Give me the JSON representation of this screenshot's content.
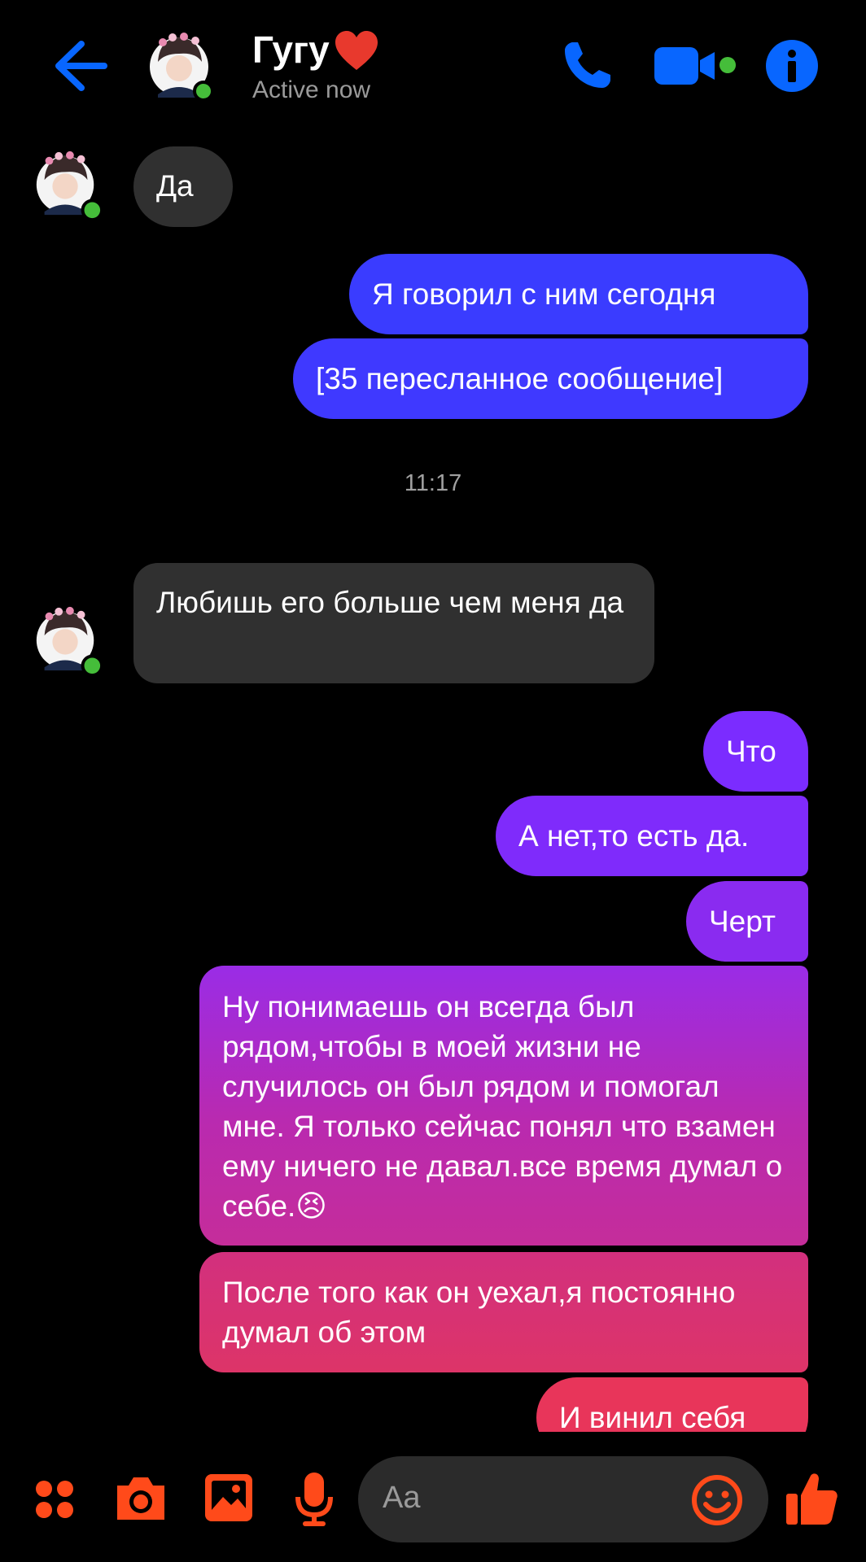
{
  "header": {
    "contact_name": "Гугу",
    "status": "Active now",
    "icons": [
      "back-arrow-icon",
      "avatar",
      "heart-icon",
      "phone-icon",
      "video-call-icon",
      "info-icon"
    ]
  },
  "messages": [
    {
      "direction": "incoming",
      "text": "Да"
    },
    {
      "direction": "outgoing",
      "text": "Я говорил с ним сегодня"
    },
    {
      "direction": "outgoing",
      "text": "[35 пересланное сообщение]"
    },
    {
      "type": "timestamp",
      "text": "11:17"
    },
    {
      "direction": "incoming",
      "text": "Любишь его больше чем меня да"
    },
    {
      "direction": "outgoing",
      "text": "Что"
    },
    {
      "direction": "outgoing",
      "text": "А нет,то есть да."
    },
    {
      "direction": "outgoing",
      "text": "Черт"
    },
    {
      "direction": "outgoing",
      "text": "Ну понимаешь он всегда был рядом,чтобы в моей жизни не случилось он был рядом и помогал мне. Я только сейчас понял что взамен ему ничего не давал.все время думал о себе.😣"
    },
    {
      "direction": "outgoing",
      "text": "После того как он уехал,я постоянно думал об этом"
    },
    {
      "direction": "outgoing",
      "text": "И винил себя"
    }
  ],
  "composer": {
    "placeholder": "Aa",
    "icons": [
      "apps-icon",
      "camera-icon",
      "gallery-icon",
      "mic-icon",
      "emoji-icon",
      "thumbs-up-icon"
    ]
  },
  "colors": {
    "accent_header": "#0866ff",
    "online": "#45bd3a",
    "incoming_bubble": "#303030",
    "outgoing_gradient": [
      "#3a3cff",
      "#7b2cff",
      "#a02cd8",
      "#d4307a",
      "#e8355a"
    ],
    "composer_accent": "#ff4a1a"
  }
}
